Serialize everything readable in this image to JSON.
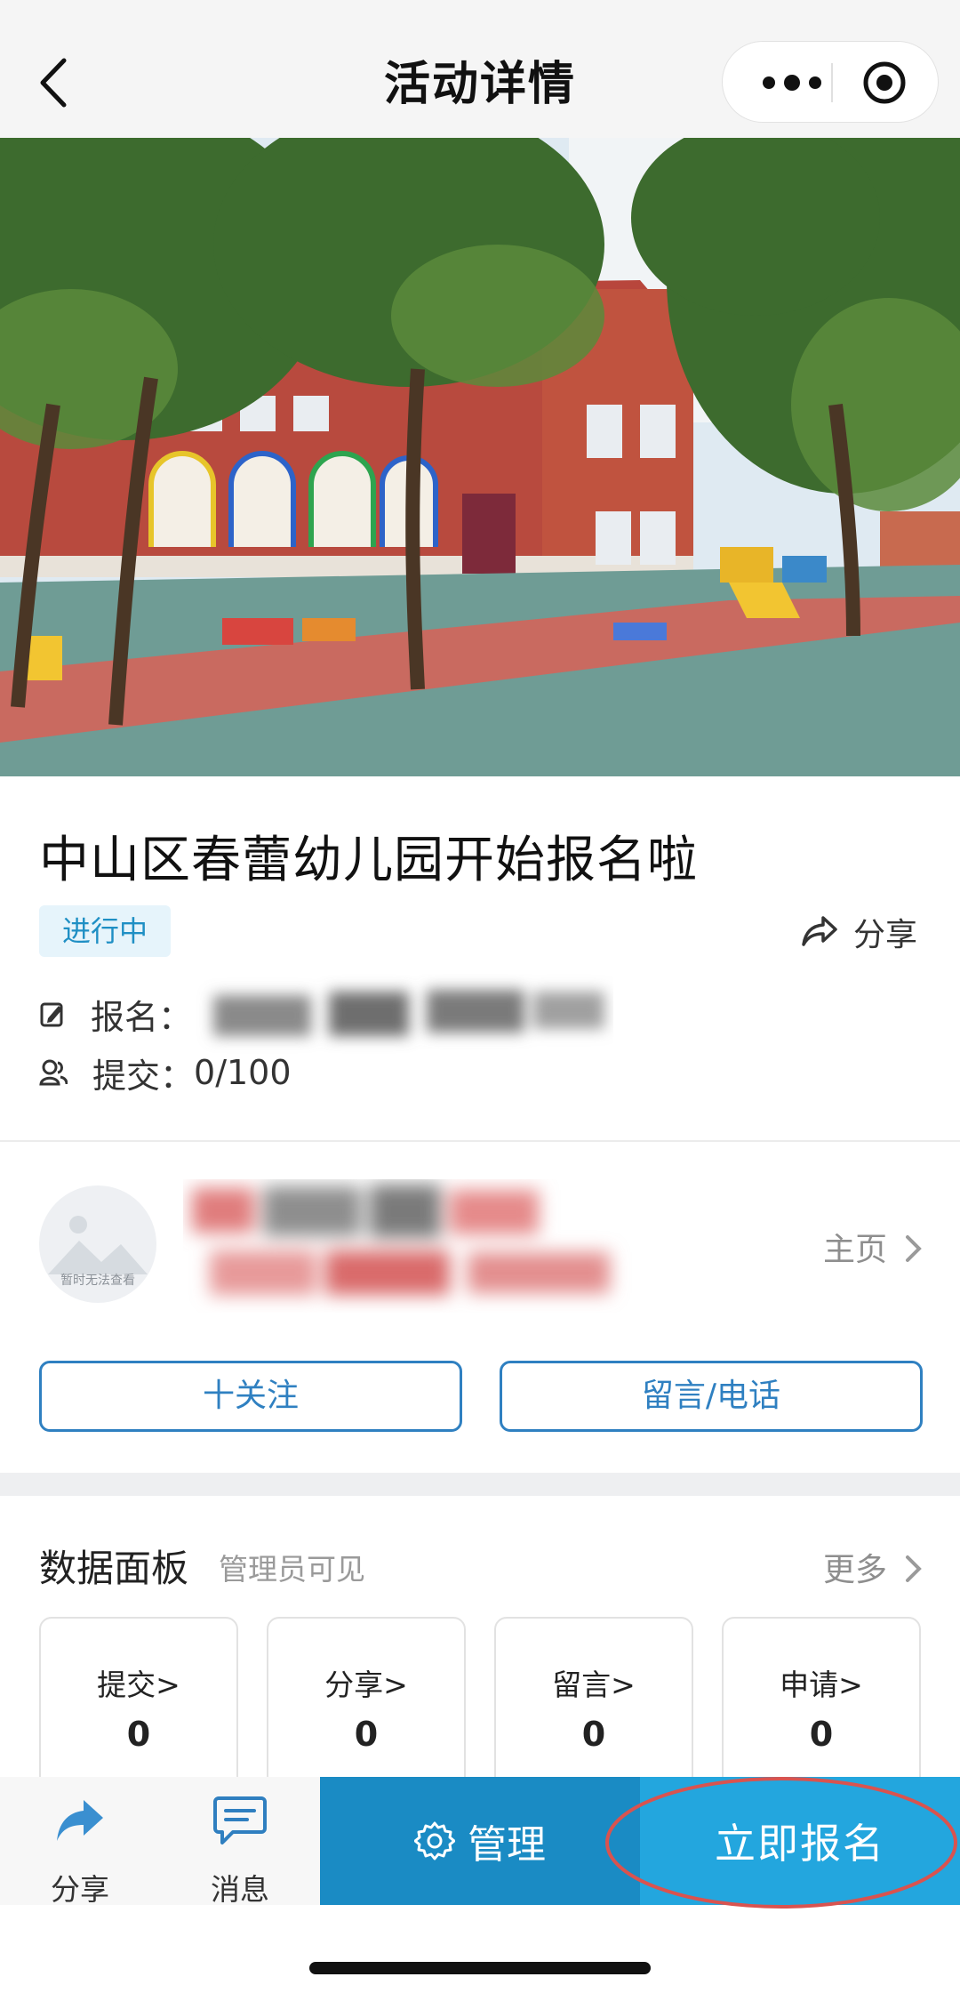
{
  "nav": {
    "title": "活动详情",
    "back_icon": "chevron-left-icon",
    "more_icon": "more-dots-icon",
    "close_icon": "target-icon"
  },
  "hero": {
    "description_icon": "kindergarten-photo"
  },
  "activity": {
    "title": "中山区春蕾幼儿园开始报名啦",
    "status": "进行中",
    "share_label": "分享",
    "signup_label": "报名：",
    "submit_label": "提交：",
    "submit_value": "0/100"
  },
  "organizer": {
    "avatar_text": "暂时无法查看",
    "homepage_label": "主页",
    "follow_label": "十关注",
    "contact_label": "留言/电话"
  },
  "panel": {
    "title": "数据面板",
    "subtitle": "管理员可见",
    "more_label": "更多",
    "stats": [
      {
        "label": "提交>",
        "value": "0"
      },
      {
        "label": "分享>",
        "value": "0"
      },
      {
        "label": "留言>",
        "value": "0"
      },
      {
        "label": "申请>",
        "value": "0"
      }
    ]
  },
  "bottom": {
    "share_label": "分享",
    "message_label": "消息",
    "manage_label": "管理",
    "signup_now_label": "立即报名"
  },
  "colors": {
    "accent": "#1a8bc4",
    "accent_light": "#23a6de",
    "outline_blue": "#2f80c1",
    "badge_bg": "#e6f4fb",
    "annotation_red": "#d9534f"
  }
}
